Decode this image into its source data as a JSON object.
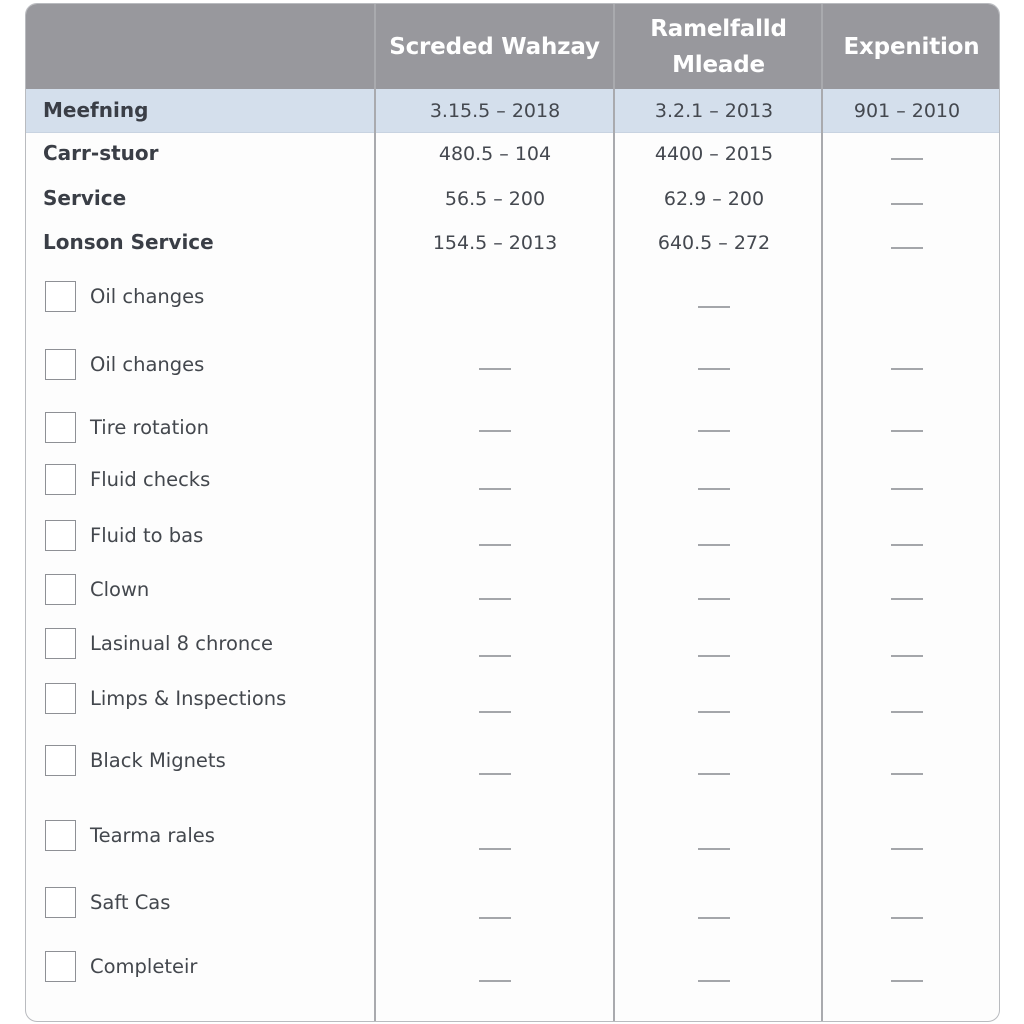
{
  "table": {
    "headers": [
      {
        "label": ""
      },
      {
        "label": "Screded Wahzay"
      },
      {
        "label": "Ramelfalld Mleade",
        "line1": "Ramelfalld",
        "line2": "Mleade"
      },
      {
        "label": "Expenition"
      }
    ],
    "highlighted_row": {
      "label": "Meefning",
      "values": [
        "3.15.5 – 2018",
        "3.2.1 – 2013",
        "901 – 2010"
      ]
    },
    "summary_rows": [
      {
        "label": "Carr-stuor",
        "values": [
          "480.5 – 104",
          "4400 – 2015",
          "—"
        ]
      },
      {
        "label": "Service",
        "values": [
          "56.5 – 200",
          "62.9 – 200",
          "—"
        ]
      },
      {
        "label": "Lonson Service",
        "values": [
          "154.5 – 2013",
          "640.5 – 272",
          "—"
        ]
      }
    ],
    "checklist": [
      {
        "label": "Oil changes",
        "checked": false,
        "values": [
          null,
          "—",
          null
        ]
      },
      {
        "label": "Oil changes",
        "checked": false,
        "values": [
          "—",
          "—",
          "—"
        ]
      },
      {
        "label": "Tire rotation",
        "checked": false,
        "values": [
          "—",
          "—",
          "—"
        ]
      },
      {
        "label": "Fluid checks",
        "checked": false,
        "values": [
          "—",
          "—",
          "—"
        ]
      },
      {
        "label": "Fluid to bas",
        "checked": false,
        "values": [
          "—",
          "—",
          "—"
        ]
      },
      {
        "label": "Clown",
        "checked": false,
        "values": [
          "—",
          "—",
          "—"
        ]
      },
      {
        "label": "Lasinual 8 chronce",
        "checked": false,
        "values": [
          "—",
          "—",
          "—"
        ]
      },
      {
        "label": "Limps & Inspections",
        "checked": false,
        "values": [
          "—",
          "—",
          "—"
        ]
      },
      {
        "label": "Black Mignets",
        "checked": false,
        "values": [
          "—",
          "—",
          "—"
        ]
      },
      {
        "label": "Tearma rales",
        "checked": false,
        "values": [
          "—",
          "—",
          "—"
        ]
      },
      {
        "label": "Saft Cas",
        "checked": false,
        "values": [
          "—",
          "—",
          "—"
        ]
      },
      {
        "label": "Completeir",
        "checked": false,
        "values": [
          "—",
          "—",
          "—"
        ]
      }
    ]
  },
  "colors": {
    "header_bg": "#98989d",
    "header_text": "#ffffff",
    "highlight_row_bg": "#d4dfec",
    "border": "#b9bbbf",
    "text": "#3f434a"
  }
}
